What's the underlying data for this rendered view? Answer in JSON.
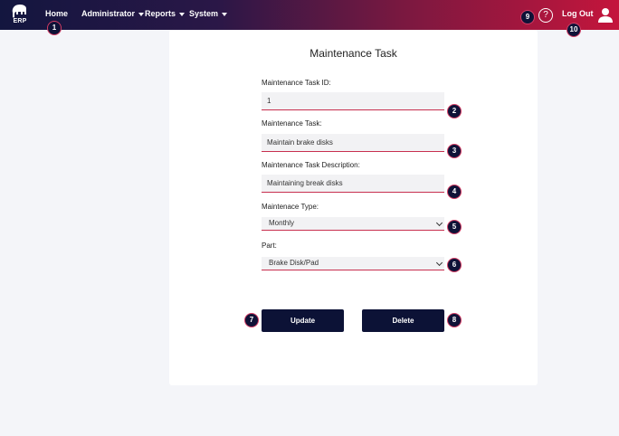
{
  "nav": {
    "logo_text": "ERP",
    "home": "Home",
    "administrator": "Administrator",
    "reports": "Reports",
    "system": "System",
    "help_glyph": "?",
    "logout": "Log Out"
  },
  "form": {
    "title": "Maintenance Task",
    "task_id": {
      "label": "Maintenance Task ID:",
      "value": "1"
    },
    "task": {
      "label": "Maintenance Task:",
      "value": "Maintain brake disks"
    },
    "description": {
      "label": "Maintenance Task Description:",
      "value": "Maintaining break disks"
    },
    "type": {
      "label": "Maintenace Type:",
      "selected": "Monthly"
    },
    "part": {
      "label": "Part:",
      "selected": "Brake Disk/Pad"
    },
    "update_label": "Update",
    "delete_label": "Delete"
  },
  "markers": [
    "1",
    "2",
    "3",
    "4",
    "5",
    "6",
    "7",
    "8",
    "9",
    "10"
  ],
  "colors": {
    "nav_start": "#13163f",
    "nav_end": "#c4153c",
    "button": "#0c1236",
    "accent": "#c8304f"
  },
  "icons": {
    "logo": "elephant-icon",
    "help": "question-circle-icon",
    "user": "user-icon"
  }
}
